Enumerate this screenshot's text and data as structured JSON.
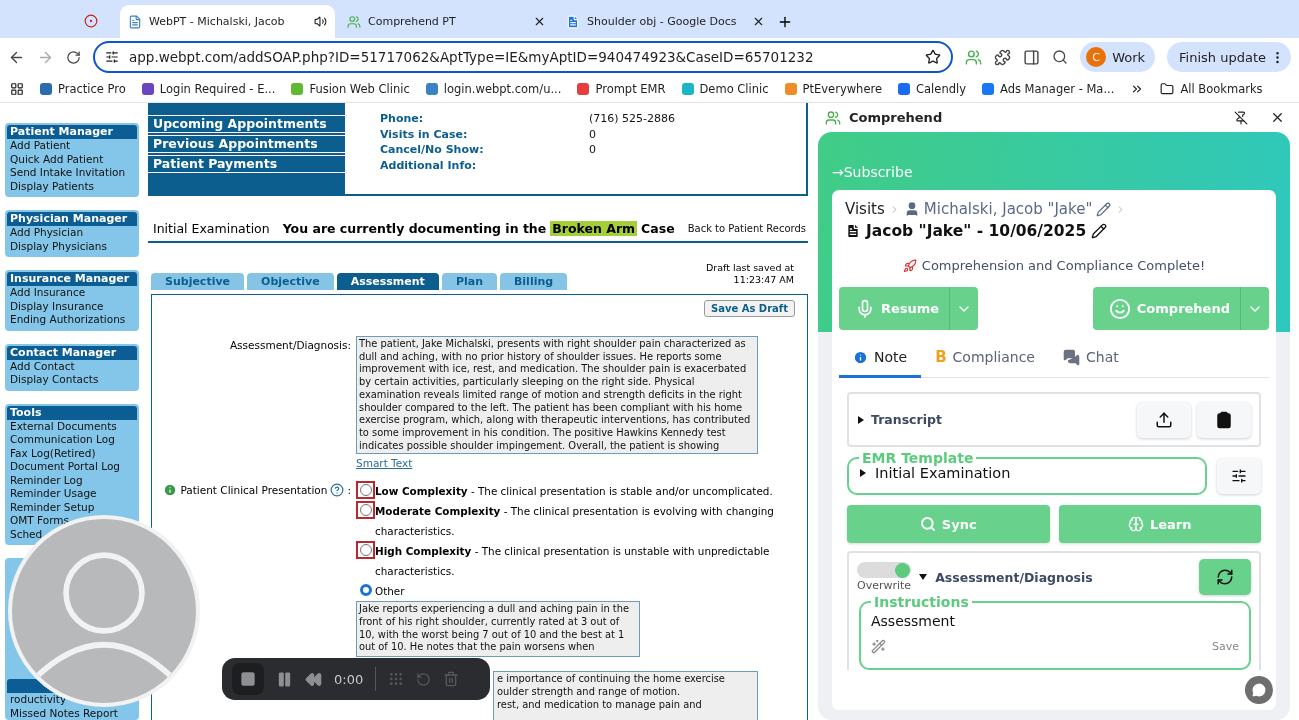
{
  "browser": {
    "tabs": [
      {
        "title": "WebPT - Michalski, Jacob",
        "selected": true,
        "audio": true,
        "kind": "page"
      },
      {
        "title": "Comprehend PT",
        "selected": false,
        "audio": false,
        "kind": "app"
      },
      {
        "title": "Shoulder obj - Google Docs",
        "selected": false,
        "audio": false,
        "kind": "doc"
      }
    ],
    "address": "app.webpt.com/addSOAP.php?ID=51717062&AptType=IE&myAptID=940474923&CaseID=65701232",
    "profile": {
      "initial": "C",
      "label": "Work"
    },
    "update_button": "Finish update",
    "bookmarks": [
      {
        "label": "Practice Pro",
        "color": "#2b6cb0"
      },
      {
        "label": "Login Required - E...",
        "color": "#6b46c1"
      },
      {
        "label": "Fusion Web Clinic",
        "color": "#5fb932"
      },
      {
        "label": "login.webpt.com/u...",
        "color": "#3b82c4"
      },
      {
        "label": "Prompt EMR",
        "color": "#e53e3e"
      },
      {
        "label": "Demo Clinic",
        "color": "#1fb5c9"
      },
      {
        "label": "PtEverywhere",
        "color": "#f08c28"
      },
      {
        "label": "Calendly",
        "color": "#1a6bf2"
      },
      {
        "label": "Ads Manager - Ma...",
        "color": "#1877f2"
      }
    ],
    "all_bookmarks": "All Bookmarks"
  },
  "sidebar": {
    "sections": [
      {
        "title": "Patient Manager",
        "items": [
          "Add Patient",
          "Quick Add Patient",
          "Send Intake Invitation",
          "Display Patients"
        ]
      },
      {
        "title": "Physician Manager",
        "items": [
          "Add Physician",
          "Display Physicians"
        ]
      },
      {
        "title": "Insurance Manager",
        "items": [
          "Add Insurance",
          "Display Insurance",
          "Ending Authorizations"
        ]
      },
      {
        "title": "Contact Manager",
        "items": [
          "Add Contact",
          "Display Contacts"
        ]
      },
      {
        "title": "Tools",
        "items": [
          "External Documents",
          "Communication Log",
          "Fax Log(Retired)",
          "Document Portal Log",
          "Reminder Log",
          "Reminder Usage",
          "Reminder Setup",
          "OMT Forms",
          "Sched"
        ]
      },
      {
        "items": [
          "roductivity",
          "Missed Notes Report"
        ]
      }
    ]
  },
  "patient": {
    "menu": [
      "Upcoming Appointments",
      "Previous Appointments",
      "Patient Payments"
    ],
    "info": [
      {
        "label": "Phone:",
        "value": "(716) 525-2886"
      },
      {
        "label": "Visits in Case:",
        "value": "0"
      },
      {
        "label": "Cancel/No Show:",
        "value": "0"
      },
      {
        "label": "Additional Info:"
      }
    ]
  },
  "note": {
    "type": "Initial Examination",
    "case_prefix": "You are currently documenting in the",
    "case_name": "Broken Arm",
    "case_suffix": "Case",
    "back_link": "Back to Patient Records",
    "tabs": [
      {
        "label": "Subjective",
        "selected": false
      },
      {
        "label": "Objective",
        "selected": false
      },
      {
        "label": "Assessment",
        "selected": true
      },
      {
        "label": "Plan",
        "selected": false
      },
      {
        "label": "Billing",
        "selected": false
      }
    ],
    "draft_status": "Draft last saved at 11:23:47 AM",
    "save_button": "Save As Draft",
    "assessment": {
      "label": "Assessment/Diagnosis:",
      "value": "The patient, Jake Michalski, presents with right shoulder pain characterized as dull and aching, with no prior history of shoulder issues. He reports some improvement with ice, rest, and medication. The shoulder pain is exacerbated by certain activities, particularly sleeping on the right side. Physical examination reveals limited range of motion and strength deficits in the right shoulder compared to the left. The patient has been compliant with his home exercise program, which, along with therapeutic interventions, has contributed to some improvement in his condition. The positive Hawkins Kennedy test indicates possible shoulder impingement. Overall, the patient is showing"
    },
    "smart_text": "Smart Text",
    "presentation": {
      "label": "Patient Clinical Presentation",
      "label_suffix": ":",
      "options": [
        {
          "text": "**Low Complexity** - The clinical presentation is stable and/or uncomplicated.",
          "selected": false,
          "flagged": true
        },
        {
          "text": "**Moderate Complexity** - The clinical presentation is evolving with changing characteristics.",
          "selected": false,
          "flagged": true
        },
        {
          "text": "**High Complexity** - The clinical presentation is unstable with unpredictable characteristics.",
          "selected": false,
          "flagged": true
        },
        {
          "text": "Other",
          "selected": true,
          "flagged": false
        }
      ],
      "other_text": "Jake reports experiencing a dull and aching pain in the front of his right shoulder, currently rated at 3 out of 10, with the worst being 7 out of 10 and the best at 1 out of 10. He notes that the pain worsens when"
    },
    "plan_text": "e importance of continuing the home exercise\noulder strength and range of motion.\nrest, and medication to manage pain and"
  },
  "recorder": {
    "time": "0:00"
  },
  "extension": {
    "title": "Comprehend",
    "subscribe": "→Subscribe",
    "breadcrumb": {
      "root": "Visits",
      "patient": "Michalski, Jacob \"Jake\""
    },
    "visit_title": "Jacob \"Jake\" - 10/06/2025",
    "status": "Comprehension and Compliance Complete!",
    "actions": [
      {
        "label": "Resume",
        "kind": "mic"
      },
      {
        "label": "Comprehend",
        "kind": "face"
      }
    ],
    "tabs": [
      {
        "label": "Note",
        "selected": true,
        "kind": "info"
      },
      {
        "label": "Compliance",
        "selected": false,
        "kind": "grade",
        "badge": "B"
      },
      {
        "label": "Chat",
        "selected": false,
        "kind": "chat"
      }
    ],
    "transcript": {
      "label": "Transcript",
      "expanded": false
    },
    "template": {
      "legend": "EMR Template",
      "value": "Initial Examination",
      "expanded": false
    },
    "buttons": [
      {
        "label": "Sync",
        "kind": "sync"
      },
      {
        "label": "Learn",
        "kind": "learn"
      }
    ],
    "section": {
      "toggle_label": "Overwrite",
      "overwrite": true,
      "title": "Assessment/Diagnosis",
      "expanded": true
    },
    "instructions": {
      "legend": "Instructions",
      "value": "Assessment",
      "save": "Save"
    }
  }
}
